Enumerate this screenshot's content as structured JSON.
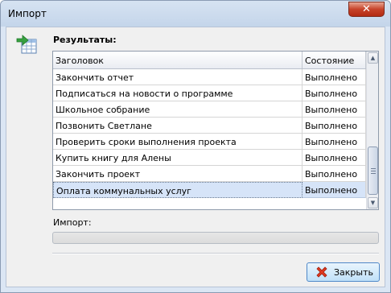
{
  "window": {
    "title": "Импорт",
    "close_glyph": "✕"
  },
  "results": {
    "label": "Результаты:"
  },
  "grid": {
    "columns": [
      "Заголовок",
      "Состояние"
    ],
    "rows": [
      {
        "title": "Закончить отчет",
        "status": "Выполнено"
      },
      {
        "title": "Подписаться на новости о программе",
        "status": "Выполнено"
      },
      {
        "title": "Школьное собрание",
        "status": "Выполнено"
      },
      {
        "title": "Позвонить Светлане",
        "status": "Выполнено"
      },
      {
        "title": "Проверить сроки выполнения проекта",
        "status": "Выполнено"
      },
      {
        "title": "Купить книгу для Алены",
        "status": "Выполнено"
      },
      {
        "title": "Закончить проект",
        "status": "Выполнено"
      },
      {
        "title": "Оплата коммунальных услуг",
        "status": "Выполнено"
      }
    ],
    "selected_row": 7
  },
  "import": {
    "label": "Импорт:",
    "progress": 0
  },
  "buttons": {
    "close_label": "Закрыть"
  },
  "icons": {
    "app": "import-table-icon",
    "close_button": "red-x-icon"
  },
  "colors": {
    "selection": "#d6e4f8",
    "close_red": "#c7432a",
    "icon_green": "#37a040"
  }
}
